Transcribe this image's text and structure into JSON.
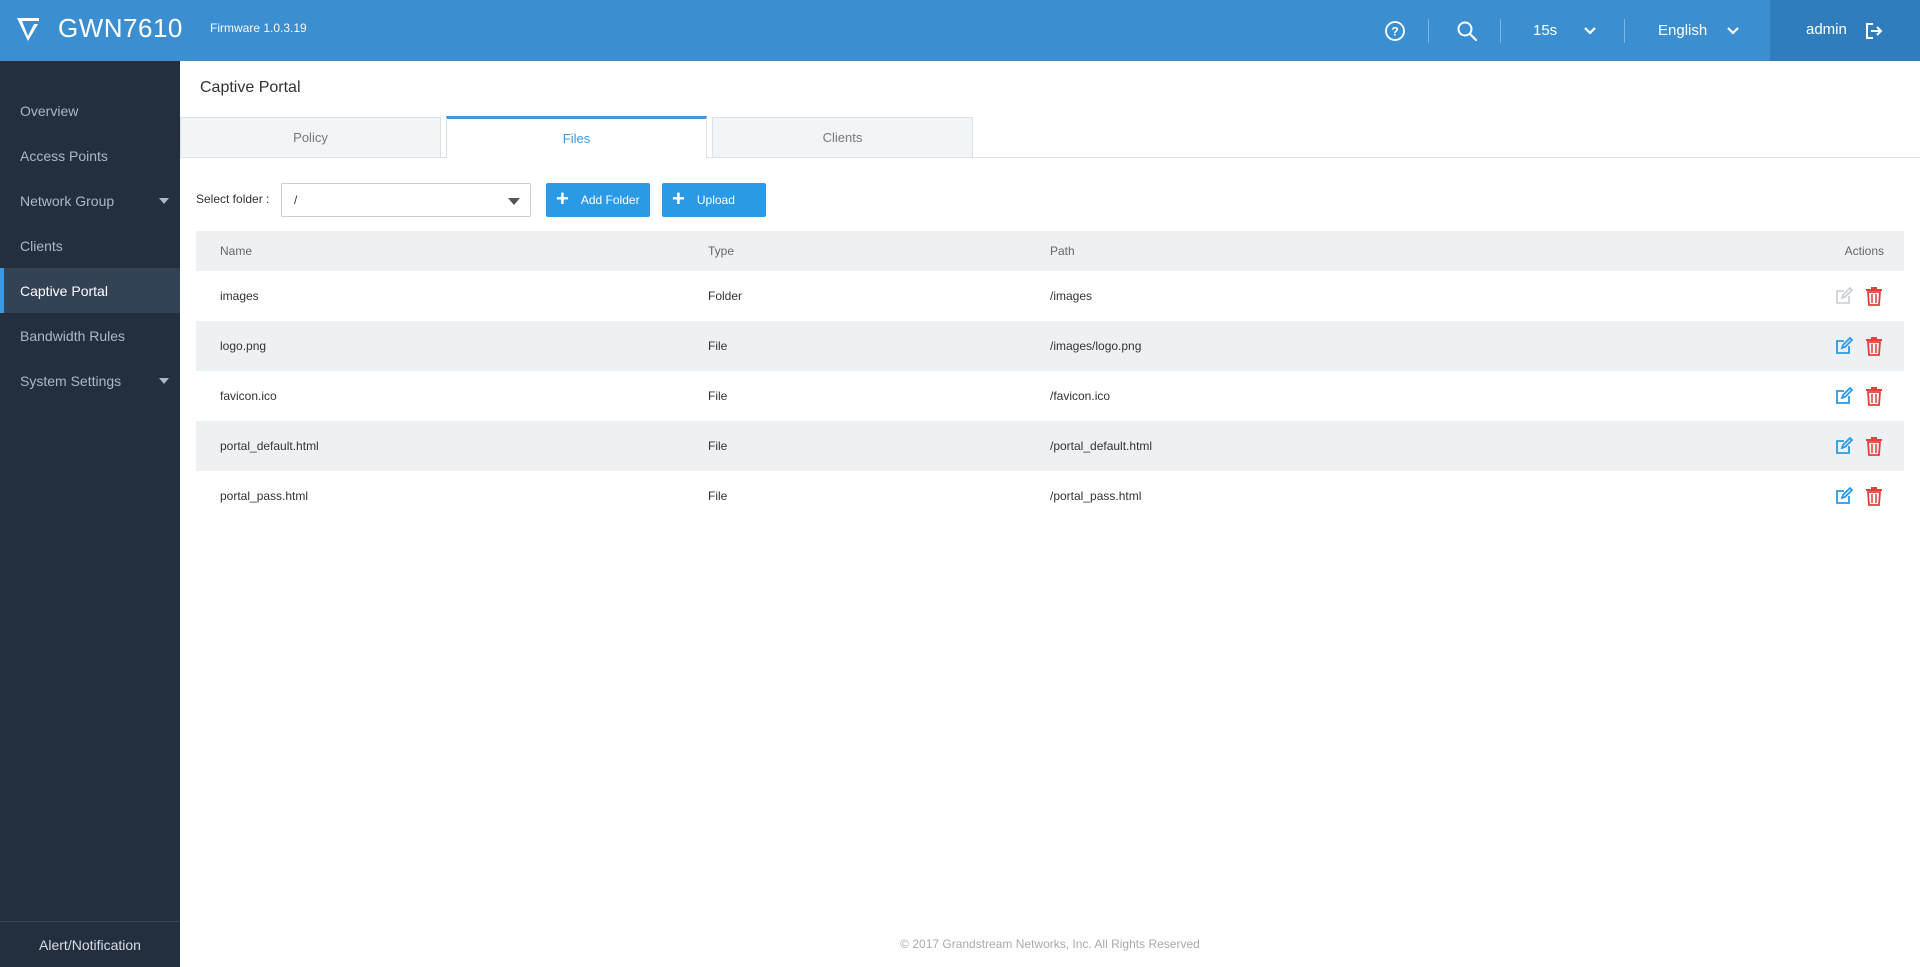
{
  "header": {
    "brand": "GWN7610",
    "firmware": "Firmware 1.0.3.19",
    "refresh_interval": "15s",
    "language": "English",
    "user": "admin"
  },
  "sidebar": {
    "items": [
      {
        "label": "Overview"
      },
      {
        "label": "Access Points"
      },
      {
        "label": "Network Group"
      },
      {
        "label": "Clients"
      },
      {
        "label": "Captive Portal"
      },
      {
        "label": "Bandwidth Rules"
      },
      {
        "label": "System Settings"
      }
    ],
    "footer": "Alert/Notification"
  },
  "main": {
    "title": "Captive Portal",
    "tabs": [
      {
        "label": "Policy"
      },
      {
        "label": "Files"
      },
      {
        "label": "Clients"
      }
    ],
    "select_label": "Select folder :",
    "select_value": "/",
    "add_folder_label": "Add Folder",
    "upload_label": "Upload",
    "table": {
      "headers": {
        "name": "Name",
        "type": "Type",
        "path": "Path",
        "actions": "Actions"
      },
      "rows": [
        {
          "name": "images",
          "type": "Folder",
          "path": "/images"
        },
        {
          "name": "logo.png",
          "type": "File",
          "path": "/images/logo.png"
        },
        {
          "name": "favicon.ico",
          "type": "File",
          "path": "/favicon.ico"
        },
        {
          "name": "portal_default.html",
          "type": "File",
          "path": "/portal_default.html"
        },
        {
          "name": "portal_pass.html",
          "type": "File",
          "path": "/portal_pass.html"
        }
      ]
    }
  },
  "footer": {
    "copyright": "© 2017 Grandstream Networks, Inc. All Rights Reserved"
  },
  "colors": {
    "header_bg": "#3b8fd0",
    "sidebar_bg": "#232e3f",
    "accent": "#2b9ae6",
    "delete_red": "#e8403a"
  }
}
